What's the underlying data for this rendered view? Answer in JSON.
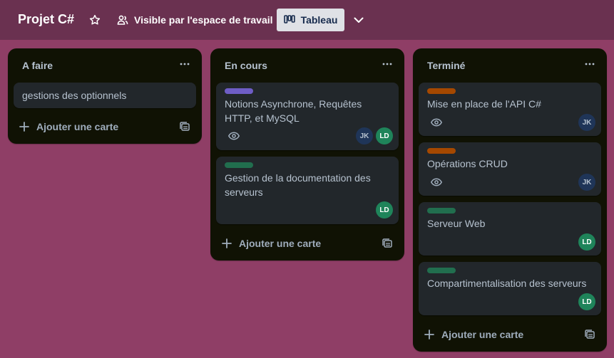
{
  "header": {
    "board_title": "Projet C#",
    "visibility_label": "Visible par l'espace de travail",
    "view_label": "Tableau"
  },
  "lists": [
    {
      "title": "A faire",
      "cards": [
        {
          "title": "gestions des optionnels"
        }
      ],
      "add_card_label": "Ajouter une carte"
    },
    {
      "title": "En cours",
      "cards": [
        {
          "label_color": "#6e5dc6",
          "title": "Notions Asynchrone, Requêtes HTTP, et MySQL",
          "watching": true,
          "members": [
            "JK",
            "LD"
          ]
        },
        {
          "label_color": "#216e4e",
          "title": "Gestion de la documentation des serveurs",
          "members": [
            "LD"
          ]
        }
      ],
      "add_card_label": "Ajouter une carte"
    },
    {
      "title": "Terminé",
      "cards": [
        {
          "label_color": "#a54800",
          "title": "Mise en place de l'API C#",
          "watching": true,
          "members": [
            "JK"
          ]
        },
        {
          "label_color": "#a54800",
          "title": "Opérations CRUD",
          "watching": true,
          "members": [
            "JK"
          ]
        },
        {
          "label_color": "#216e4e",
          "title": "Serveur Web",
          "members": [
            "LD"
          ]
        },
        {
          "label_color": "#216e4e",
          "title": "Compartimentalisation des serveurs",
          "members": [
            "LD"
          ]
        }
      ],
      "add_card_label": "Ajouter une carte"
    }
  ],
  "icons": {
    "star": "star-icon",
    "visibility": "people-icon",
    "view": "board-icon",
    "expand": "chevron-down-icon",
    "list_menu": "more-icon",
    "watch": "eye-icon",
    "add": "plus-icon",
    "template": "card-template-icon"
  }
}
